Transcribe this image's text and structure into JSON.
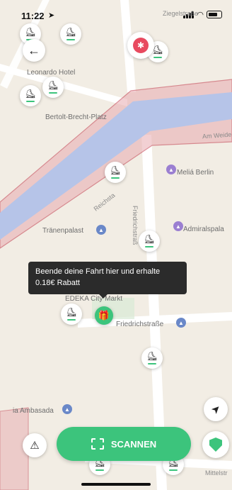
{
  "status_bar": {
    "time": "11:22"
  },
  "map": {
    "labels": {
      "ziegelstrasse": "Ziegelstraße",
      "leonardo_hotel": "Leonardo Hotel",
      "bertolt_brecht_platz": "Bertolt-Brecht-Platz",
      "am_weide": "Am Weide",
      "melia_berlin": "Meliá Berlin",
      "friedrichstrasse_vertical": "Friedrichstraß",
      "reichstag": "Reichsta",
      "admiralspalast": "Admiralspala",
      "traenenpalast": "Tränenpalast",
      "edeka_city_markt": "EDEKA City Markt",
      "friedrichstrasse_station": "Friedrichstraße",
      "embassy": "ia Ambasada",
      "mittelstrasse": "Mittelstr"
    }
  },
  "tooltip": {
    "line1": "Beende deine Fahrt hier und erhalte",
    "line2": "0.18€ Rabatt"
  },
  "scan_button": {
    "label": "SCANNEN"
  },
  "colors": {
    "accent": "#3cc47c",
    "water": "#b6c4e8",
    "parking_zone": "#e8aab0",
    "bug_badge": "#e84a5f"
  },
  "icons": {
    "back": "arrow-left-icon",
    "bug": "bug-icon",
    "navigate": "location-arrow-icon",
    "warning": "warning-icon",
    "shield": "shield-icon",
    "scooter": "scooter-icon",
    "gift": "gift-icon",
    "scan": "scan-icon"
  }
}
